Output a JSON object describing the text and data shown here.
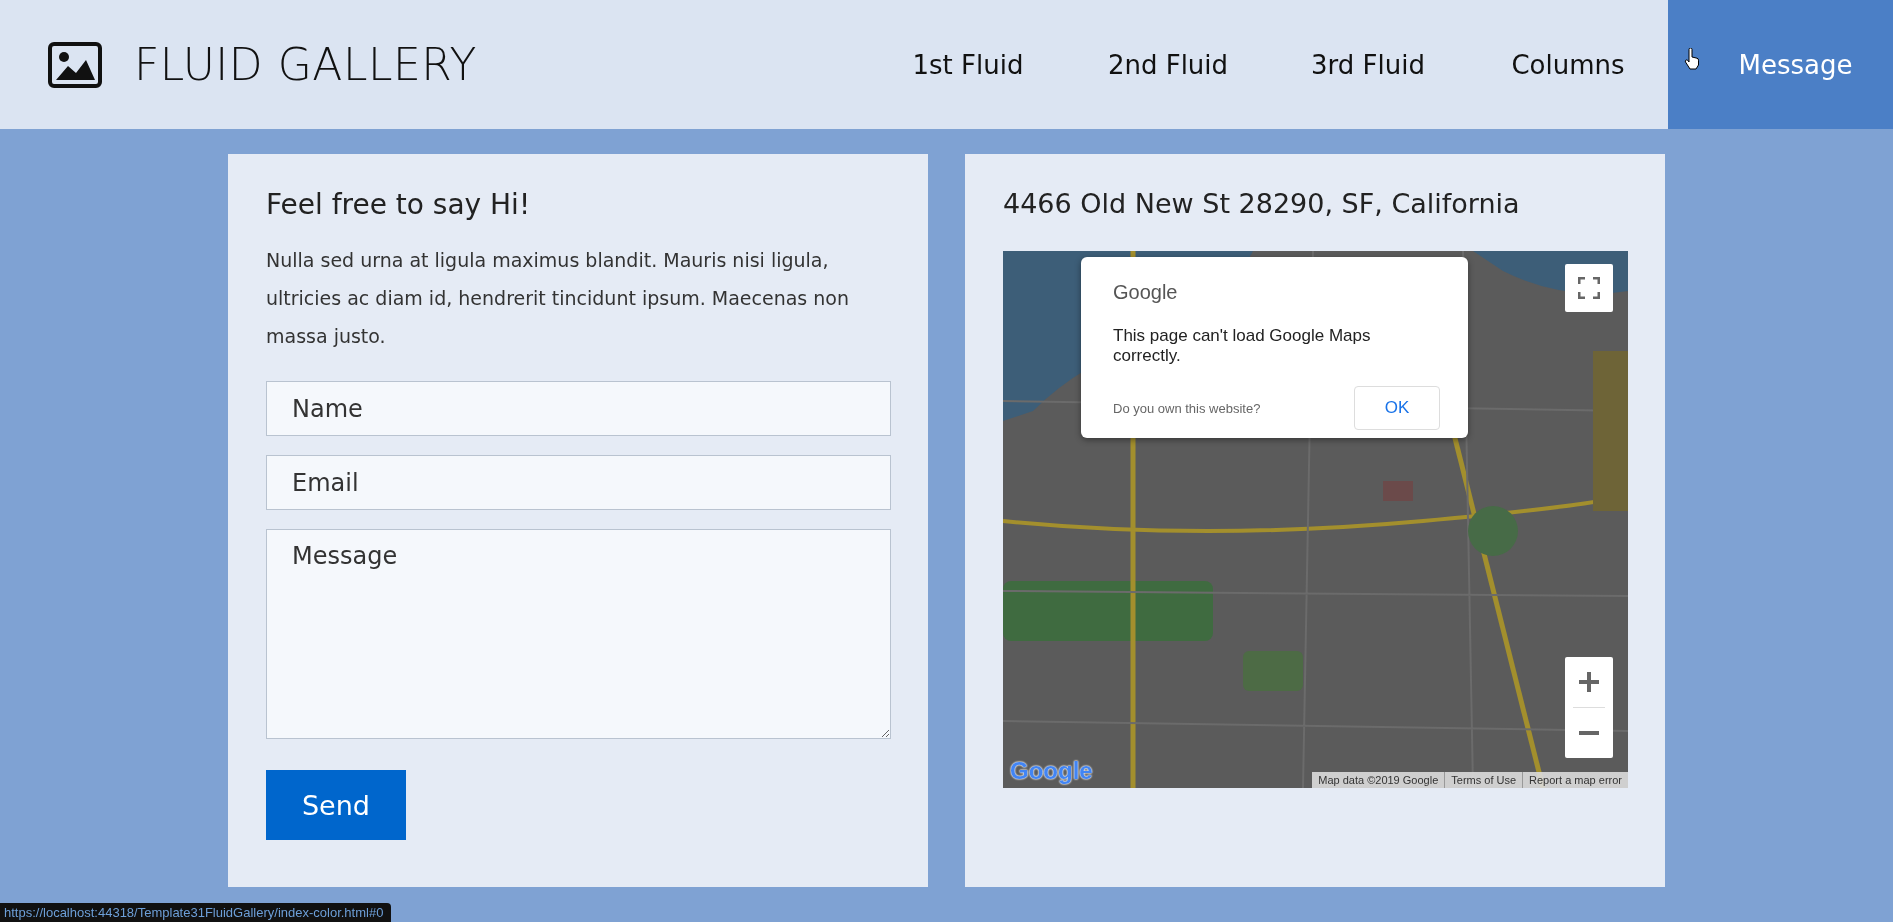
{
  "header": {
    "logo_text": "FLUID GALLERY",
    "nav": [
      {
        "label": "1st Fluid",
        "selected": false
      },
      {
        "label": "2nd Fluid",
        "selected": false
      },
      {
        "label": "3rd Fluid",
        "selected": false
      },
      {
        "label": "Columns",
        "selected": false
      },
      {
        "label": "Message",
        "selected": true
      }
    ]
  },
  "contact": {
    "title": "Feel free to say Hi!",
    "text": "Nulla sed urna at ligula maximus blandit. Mauris nisi ligula, ultricies ac diam id, hendrerit tincidunt ipsum. Maecenas non massa justo.",
    "fields": [
      {
        "placeholder": "Name",
        "kind": "input"
      },
      {
        "placeholder": "Email",
        "kind": "input"
      },
      {
        "placeholder": "Message",
        "kind": "textarea"
      }
    ],
    "button": "Send"
  },
  "location": {
    "address": "4466 Old New St 28290, SF, California",
    "map": {
      "kind": "picture",
      "logo": "Google",
      "dialog": {
        "brand": "Google",
        "message": "This page can't load Google Maps correctly.",
        "link": "Do you own this website?",
        "button": "OK"
      },
      "attribution": [
        "Map data ©2019 Google",
        "Terms of Use",
        "Report a map error"
      ]
    }
  },
  "status_bar": {
    "url": "https://localhost:44318/Template31FluidGallery/index-color.html#0"
  }
}
